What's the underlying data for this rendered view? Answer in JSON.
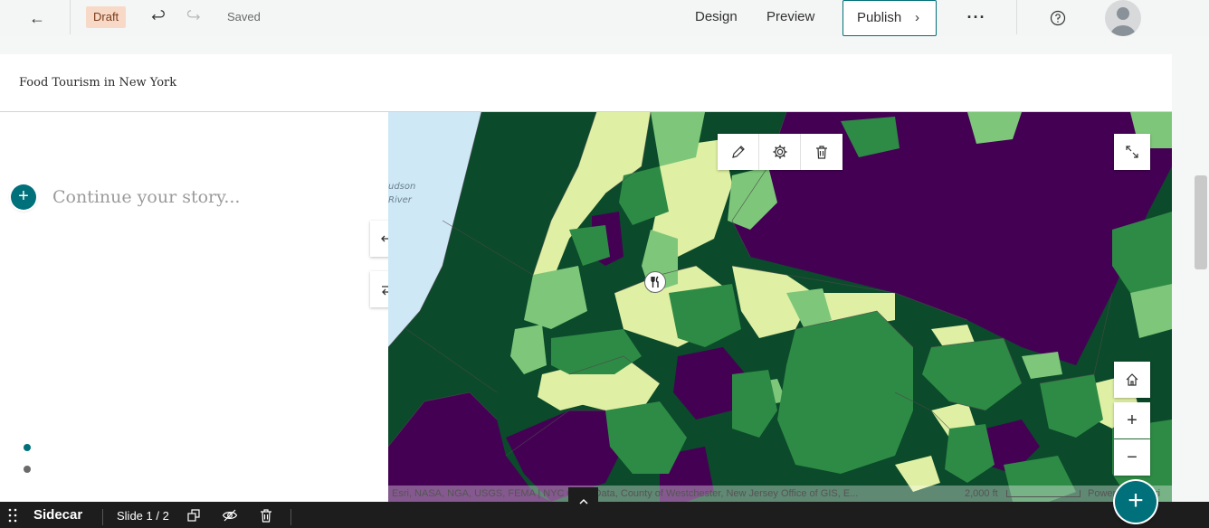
{
  "topbar": {
    "back_icon": "arrow-left-icon",
    "status_badge": "Draft",
    "undo_icon": "undo-icon",
    "redo_icon": "redo-icon",
    "save_status": "Saved",
    "nav": {
      "design": "Design",
      "preview": "Preview"
    },
    "publish_label": "Publish",
    "more_icon": "more-horizontal-icon",
    "help_icon": "question-circle-icon",
    "avatar_icon": "user-avatar-icon"
  },
  "story": {
    "title": "Food Tourism in New York",
    "placeholder": "Continue your story..."
  },
  "slides": {
    "dots": [
      "active",
      "inactive"
    ],
    "active_color": "#00707a",
    "inactive_color": "#6a6a6a"
  },
  "map": {
    "water_labels": [
      "udson",
      "River"
    ],
    "attribution": "Esri, NASA, NGA, USGS, FEMA | NYC Open Data, County of Westchester, New Jersey Office of GIS, E...",
    "scale_label": "2,000 ft",
    "powered": "Powered by Esri",
    "colors": {
      "dark_purple": "#440154",
      "dark_green": "#0b4a2a",
      "mid_green": "#2e8b45",
      "light_green": "#7ec77a",
      "pale": "#dff0a4",
      "water": "#cfe8f6"
    }
  },
  "bottombar": {
    "layout_label": "Sidecar",
    "slide_label": "Slide 1 / 2"
  }
}
